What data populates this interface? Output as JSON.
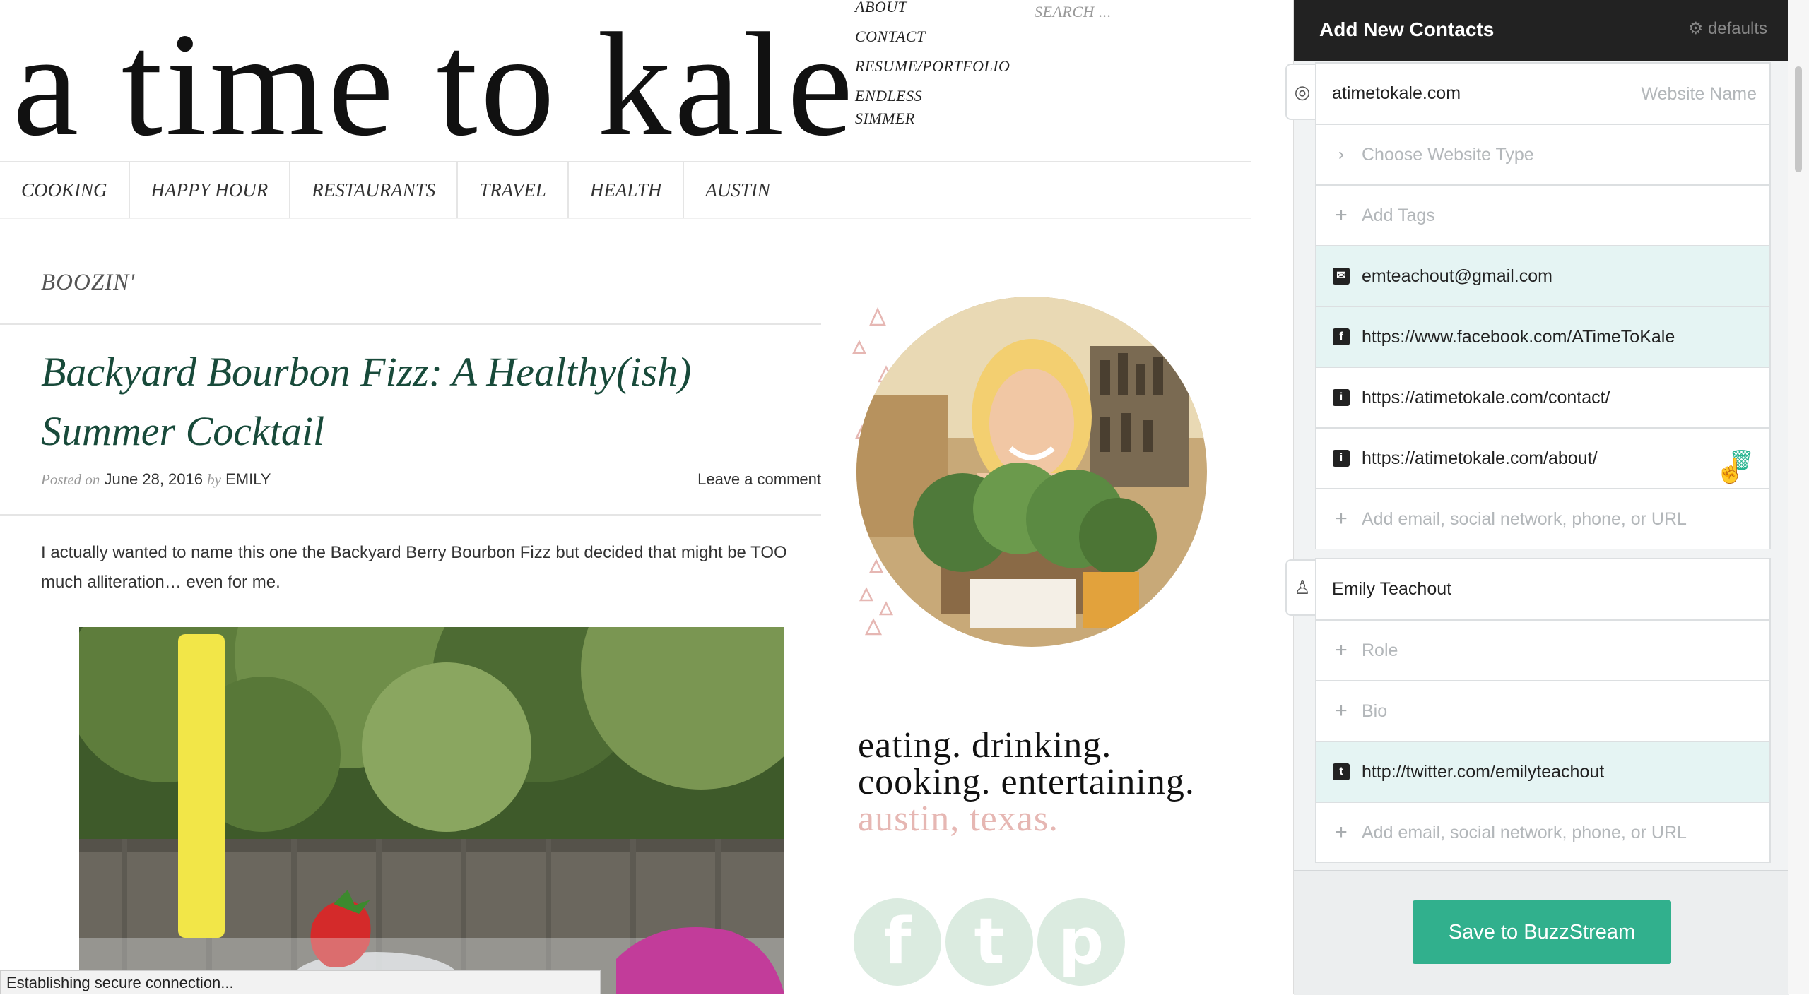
{
  "blog": {
    "logo": "a time to kale",
    "top_nav": [
      "ABOUT",
      "CONTACT",
      "RESUME/PORTFOLIO",
      "ENDLESS SIMMER"
    ],
    "search_placeholder": "SEARCH ...",
    "categories": [
      "COOKING",
      "HAPPY HOUR",
      "RESTAURANTS",
      "TRAVEL",
      "HEALTH",
      "AUSTIN"
    ],
    "category_heading": "BOOZIN'",
    "post_title": "Backyard Bourbon Fizz: A Healthy(ish) Summer Cocktail",
    "posted_on_label": "Posted on",
    "post_date": "June 28, 2016",
    "by_label": "by",
    "author": "EMILY",
    "comment_link": "Leave a comment",
    "excerpt": "I actually wanted to name this one the Backyard Berry Bourbon Fizz but decided that might be TOO much alliteration… even for me.",
    "tagline_line1": "eating. drinking.",
    "tagline_line2": "cooking. entertaining.",
    "tagline_line3": "austin, texas.",
    "social_icons": [
      "facebook-icon",
      "twitter-icon",
      "pinterest-icon"
    ],
    "status_text": "Establishing secure connection..."
  },
  "panel": {
    "title": "Add New Contacts",
    "defaults_label": "defaults",
    "website": {
      "value": "atimetokale.com",
      "name_placeholder": "Website Name",
      "type_placeholder": "Choose Website Type",
      "tags_placeholder": "Add Tags",
      "links": [
        {
          "icon": "mail-icon",
          "value": "emteachout@gmail.com",
          "highlight": true
        },
        {
          "icon": "facebook-icon",
          "value": "https://www.facebook.com/ATimeToKale",
          "highlight": true
        },
        {
          "icon": "info-icon",
          "value": "https://atimetokale.com/contact/",
          "highlight": false
        },
        {
          "icon": "info-icon",
          "value": "https://atimetokale.com/about/",
          "highlight": false
        }
      ],
      "add_link_placeholder": "Add email, social network, phone, or URL"
    },
    "person": {
      "name": "Emily Teachout",
      "role_placeholder": "Role",
      "bio_placeholder": "Bio",
      "links": [
        {
          "icon": "twitter-icon",
          "value": "http://twitter.com/emilyteachout",
          "highlight": true
        }
      ],
      "add_link_placeholder": "Add email, social network, phone, or URL"
    },
    "save_button": "Save to BuzzStream",
    "colors": {
      "accent": "#31b08d",
      "header": "#222222",
      "highlight_row": "#e5f4f3",
      "post_title": "#184a3a",
      "tagline_pink": "#e6b7b3"
    }
  }
}
